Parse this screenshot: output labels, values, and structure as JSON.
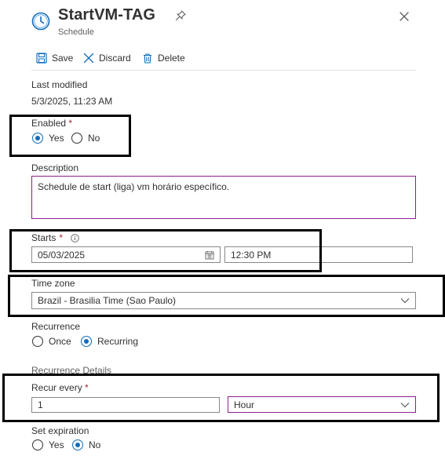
{
  "header": {
    "title": "StartVM-TAG",
    "subtitle": "Schedule",
    "icon": "clock-icon",
    "pin_icon": "pin-icon",
    "close_icon": "close-icon"
  },
  "toolbar": {
    "save_label": "Save",
    "discard_label": "Discard",
    "delete_label": "Delete"
  },
  "last_modified": {
    "label": "Last modified",
    "value": "5/3/2025, 11:23 AM"
  },
  "enabled": {
    "label": "Enabled",
    "required_mark": "*",
    "options": [
      "Yes",
      "No"
    ],
    "selected": "Yes"
  },
  "description": {
    "label": "Description",
    "value": "Schedule de start (liga) vm horário específico."
  },
  "starts": {
    "label": "Starts",
    "required_mark": "*",
    "info_icon": "info-icon",
    "date": "05/03/2025",
    "time": "12:30 PM"
  },
  "time_zone": {
    "label": "Time zone",
    "value": "Brazil - Brasilia Time (Sao Paulo)"
  },
  "recurrence": {
    "label": "Recurrence",
    "options": [
      "Once",
      "Recurring"
    ],
    "selected": "Recurring"
  },
  "recurrence_details": {
    "heading": "Recurrence Details",
    "recur_every_label": "Recur every",
    "required_mark": "*",
    "interval": "1",
    "unit": "Hour"
  },
  "set_expiration": {
    "label": "Set expiration",
    "options": [
      "Yes",
      "No"
    ],
    "selected": "No"
  },
  "colors": {
    "accent": "#0f6cbd",
    "required": "#a4262c",
    "field_focus_border": "#8e1e8e",
    "highlight_box": "#000000"
  }
}
